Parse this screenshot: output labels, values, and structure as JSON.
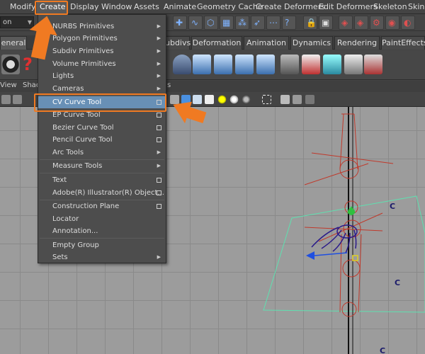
{
  "menubar": {
    "items": [
      "Modify",
      "Create",
      "Display",
      "Window",
      "Assets",
      "Animate",
      "Geometry Cache",
      "Create Deformers",
      "Edit Deformers",
      "Skeleton",
      "Skin"
    ]
  },
  "toolbar": {
    "mode_value": "on"
  },
  "shelf": {
    "tabs": [
      "eneral",
      "ubdivs",
      "Deformation",
      "Animation",
      "Dynamics",
      "Rendering",
      "PaintEffects"
    ]
  },
  "panel": {
    "menus": [
      "View",
      "Shad",
      "s"
    ]
  },
  "create_menu": {
    "items": [
      {
        "label": "NURBS Primitives",
        "submenu": true
      },
      {
        "label": "Polygon Primitives",
        "submenu": true
      },
      {
        "label": "Subdiv Primitives",
        "submenu": true
      },
      {
        "label": "Volume Primitives",
        "submenu": true
      },
      {
        "label": "Lights",
        "submenu": true
      },
      {
        "label": "Cameras",
        "submenu": true
      },
      {
        "label": "CV Curve Tool",
        "option": true,
        "highlighted": true
      },
      {
        "label": "EP Curve Tool",
        "option": true
      },
      {
        "label": "Bezier Curve Tool",
        "option": true
      },
      {
        "label": "Pencil Curve Tool",
        "option": true
      },
      {
        "label": "Arc Tools",
        "submenu": true
      },
      {
        "label": "Measure Tools",
        "submenu": true
      },
      {
        "label": "Text",
        "option": true
      },
      {
        "label": "Adobe(R) Illustrator(R) Object...",
        "option": true
      },
      {
        "label": "Construction Plane",
        "option": true
      },
      {
        "label": "Locator"
      },
      {
        "label": "Annotation..."
      },
      {
        "label": "Empty Group"
      },
      {
        "label": "Sets",
        "submenu": true
      }
    ]
  },
  "viewport": {
    "labels": [
      "C",
      "C",
      "C"
    ]
  },
  "colors": {
    "highlight": "#6890b6",
    "callout": "#f07a22",
    "curve_plane": "#5fe0b0",
    "joints": "#c0392b"
  }
}
